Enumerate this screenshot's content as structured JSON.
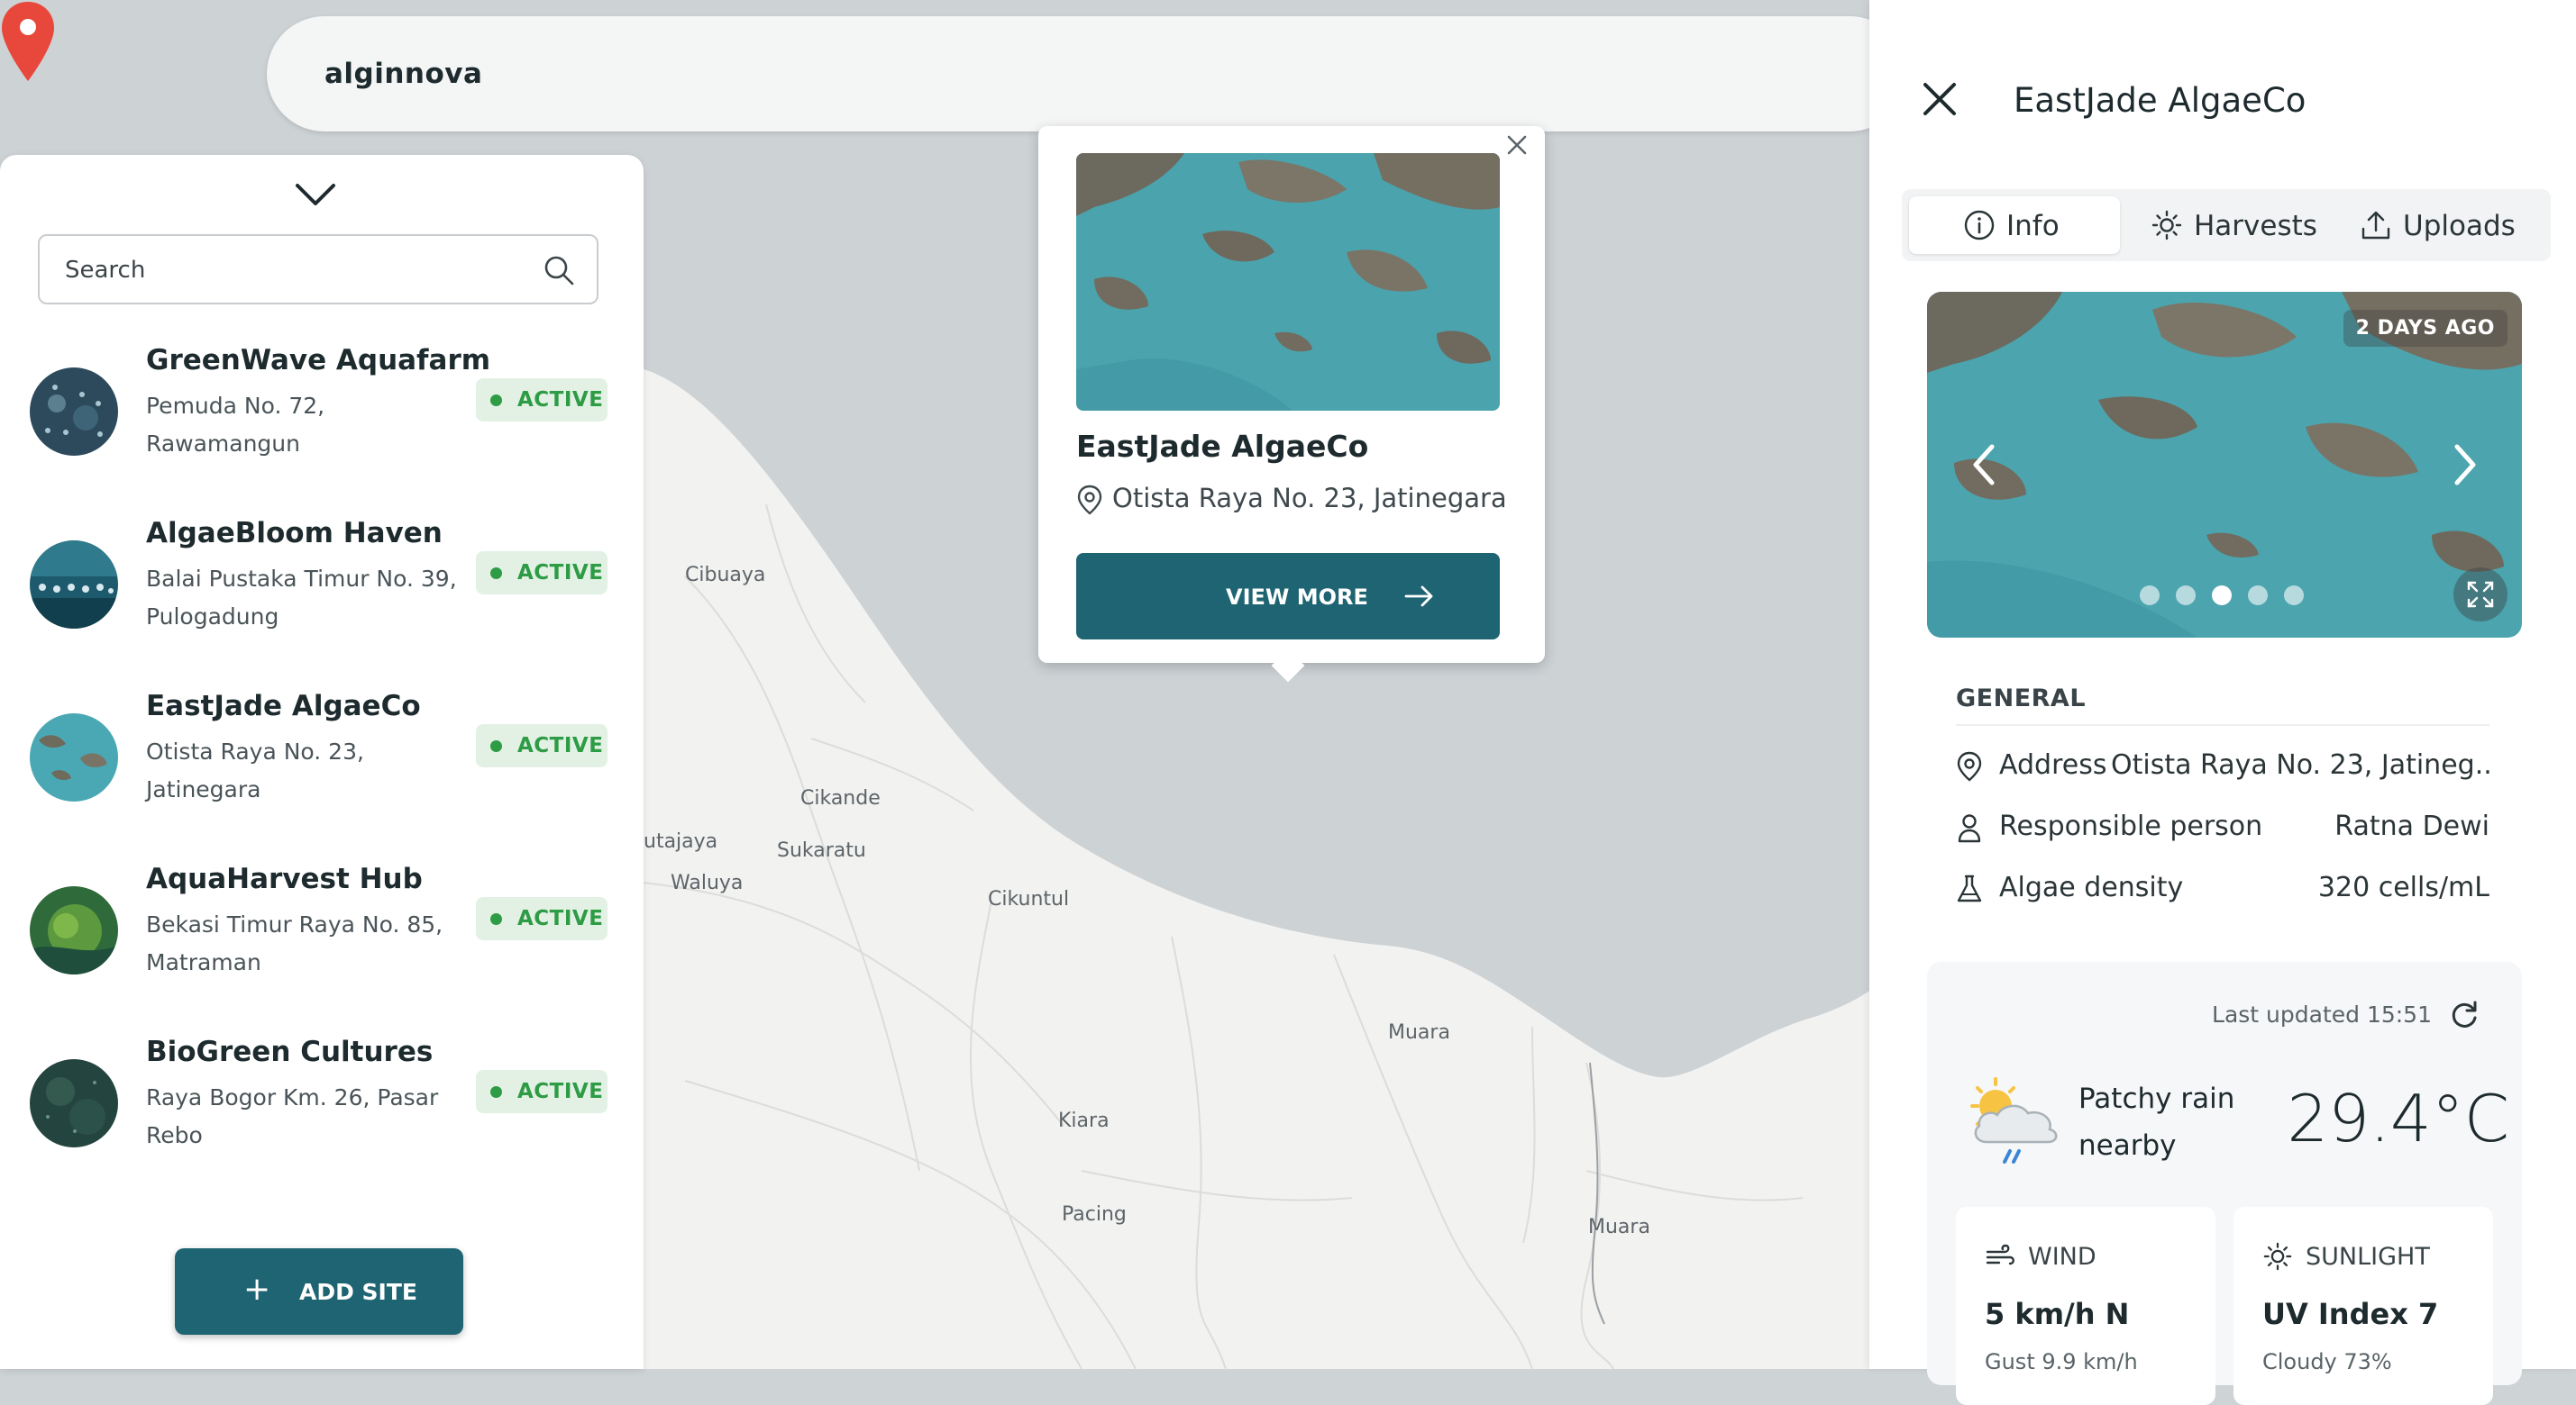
{
  "topbar": {
    "brand": "alginnova"
  },
  "search": {
    "placeholder": "Search"
  },
  "sites": [
    {
      "name": "GreenWave Aquafarm",
      "address": "Pemuda No. 72, Rawamangun",
      "status": "ACTIVE"
    },
    {
      "name": "AlgaeBloom Haven",
      "address": "Balai Pustaka Timur No. 39, Pulogadung",
      "status": "ACTIVE"
    },
    {
      "name": "EastJade AlgaeCo",
      "address": "Otista Raya No. 23, Jatinegara",
      "status": "ACTIVE"
    },
    {
      "name": "AquaHarvest Hub",
      "address": "Bekasi Timur Raya No. 85, Matraman",
      "status": "ACTIVE"
    },
    {
      "name": "BioGreen Cultures",
      "address": "Raya Bogor Km. 26, Pasar Rebo",
      "status": "ACTIVE"
    }
  ],
  "add_site_label": "ADD SITE",
  "map": {
    "places": [
      "Cibuaya",
      "Cikande",
      "utajaya",
      "Sukaratu",
      "Waluya",
      "Cikuntul",
      "Muara",
      "Kiara",
      "Pacing",
      "Muara"
    ]
  },
  "popup": {
    "title": "EastJade AlgaeCo",
    "address": "Otista Raya No. 23, Jatinegara",
    "button": "VIEW MORE"
  },
  "detail": {
    "title": "EastJade AlgaeCo",
    "tabs": [
      {
        "label": "Info",
        "icon": "info-icon",
        "active": true
      },
      {
        "label": "Harvests",
        "icon": "sun-icon",
        "active": false
      },
      {
        "label": "Uploads",
        "icon": "upload-icon",
        "active": false
      }
    ],
    "gallery": {
      "badge": "2 DAYS AGO",
      "slide_count": 5,
      "active_slide": 3
    },
    "general": {
      "title": "GENERAL",
      "rows": [
        {
          "label": "Address",
          "value": "Otista Raya No. 23, Jatineg...",
          "icon": "location-icon"
        },
        {
          "label": "Responsible person",
          "value": "Ratna Dewi",
          "icon": "person-icon"
        },
        {
          "label": "Algae density",
          "value": "320 cells/mL",
          "icon": "flask-icon"
        }
      ]
    },
    "weather": {
      "updated": "Last updated 15:51",
      "condition": "Patchy rain nearby",
      "temperature": "29.4°C",
      "wind": {
        "title": "WIND",
        "value": "5 km/h N",
        "sub": "Gust 9.9 km/h"
      },
      "sunlight": {
        "title": "SUNLIGHT",
        "value": "UV Index 7",
        "sub": "Cloudy 73%"
      }
    }
  },
  "colors": {
    "primary": "#1f6472",
    "active_green": "#2e9b45",
    "badge_bg": "#e3f1e5",
    "pin": "#e8473b"
  }
}
